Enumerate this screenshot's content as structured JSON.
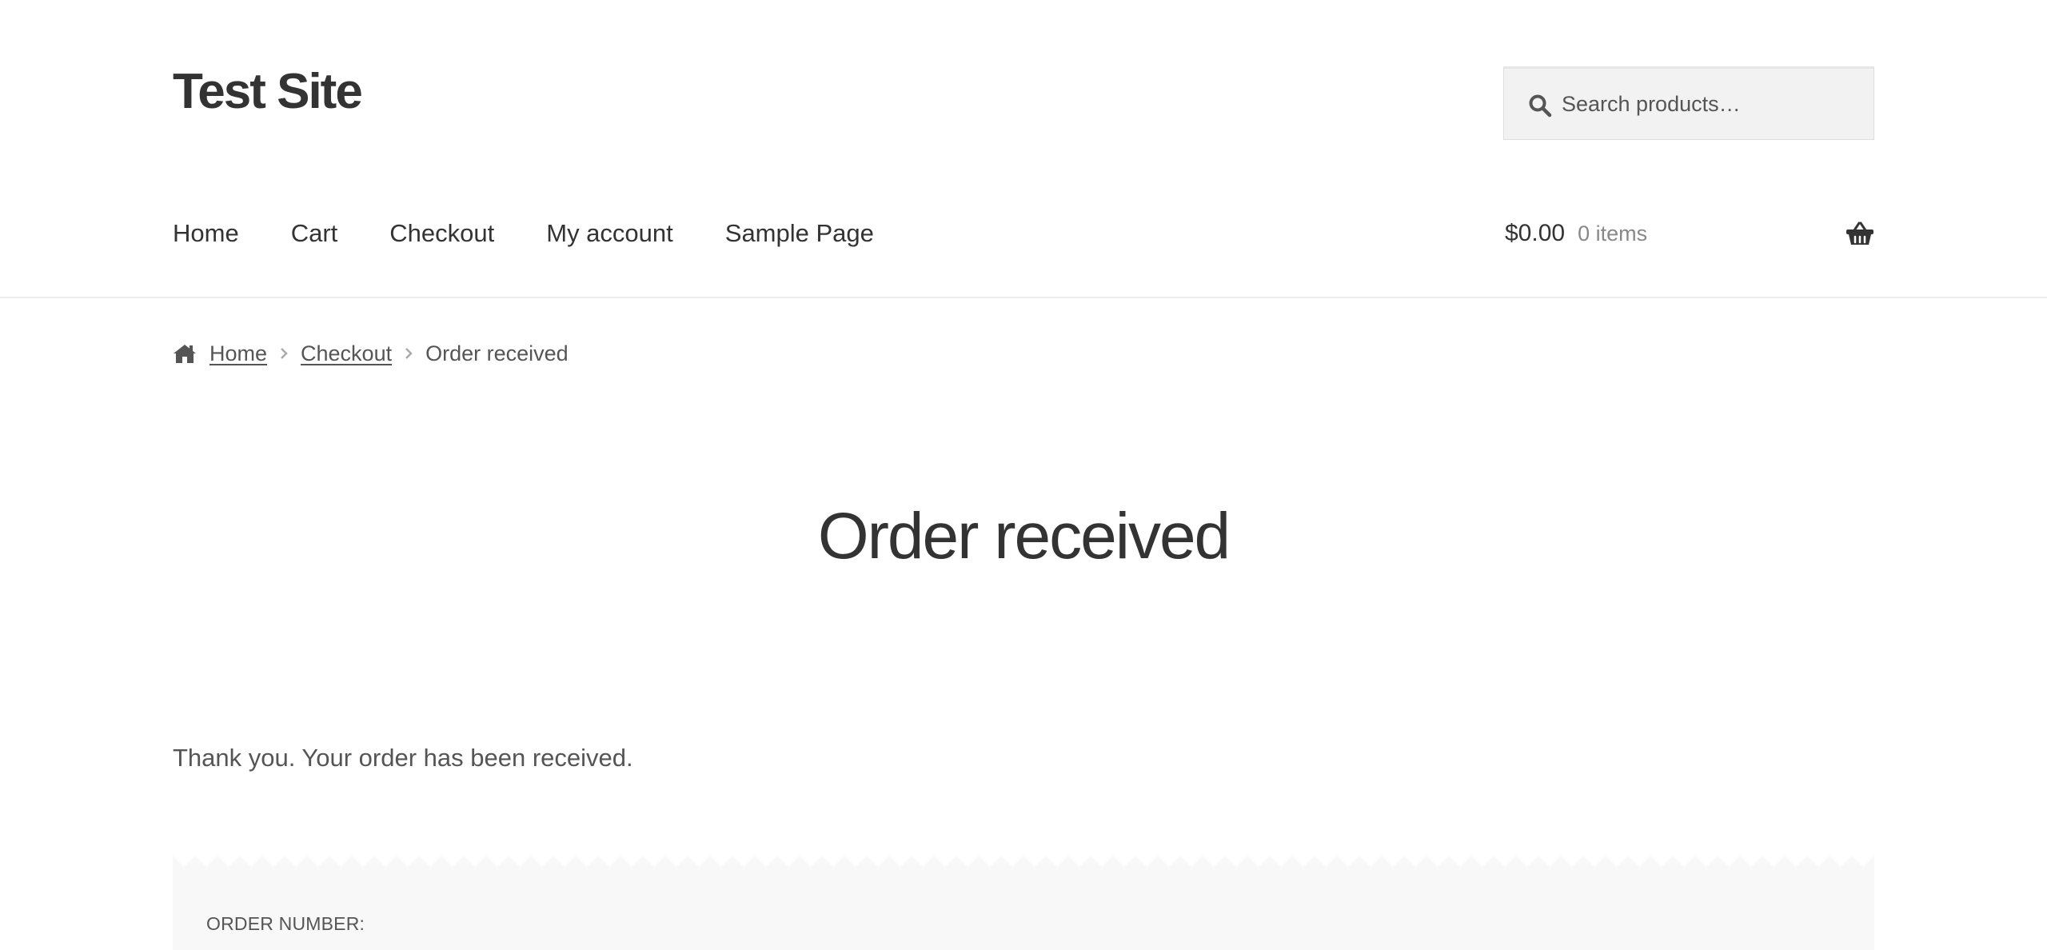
{
  "header": {
    "site_title": "Test Site",
    "search": {
      "placeholder": "Search products…",
      "icon": "search-icon"
    }
  },
  "nav": {
    "items": [
      {
        "label": "Home"
      },
      {
        "label": "Cart"
      },
      {
        "label": "Checkout"
      },
      {
        "label": "My account"
      },
      {
        "label": "Sample Page"
      }
    ]
  },
  "cart": {
    "amount": "$0.00",
    "count": "0 items",
    "icon": "basket-icon"
  },
  "breadcrumb": {
    "home_icon": "home-icon",
    "home": "Home",
    "checkout": "Checkout",
    "current": "Order received"
  },
  "main": {
    "title": "Order received",
    "thank_you": "Thank you. Your order has been received.",
    "order_number_label": "ORDER NUMBER:"
  },
  "colors": {
    "text": "#333333",
    "muted": "#555555",
    "cart_count": "#888888",
    "search_bg": "#f2f2f2",
    "overview_bg": "#f8f8f8"
  }
}
